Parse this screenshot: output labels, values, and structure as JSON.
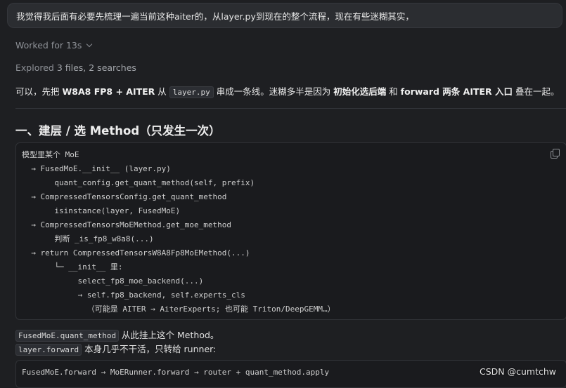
{
  "user_message": "我觉得我后面有必要先梳理一遍当前这种aiter的，从layer.py到现在的整个流程，现在有些迷糊其实，",
  "worked": {
    "label": "Worked for 13s"
  },
  "explored": {
    "label": "Explored",
    "detail": "3 files, 2 searches"
  },
  "summary": {
    "p1": "可以，先把 ",
    "b1": "W8A8 FP8 + AITER",
    "p2": " 从 ",
    "code": "layer.py",
    "p3": " 串成一条线。迷糊多半是因为 ",
    "b2": "初始化选后端",
    "p4": " 和 ",
    "b3": "forward 两条 AITER 入口",
    "p5": " 叠在一起。"
  },
  "heading": "一、建层 / 选 Method（只发生一次）",
  "code_lines": [
    "模型里某个 MoE",
    "  → FusedMoE.__init__ (layer.py)",
    "       quant_config.get_quant_method(self, prefix)",
    "  → CompressedTensorsConfig.get_quant_method",
    "       isinstance(layer, FusedMoE)",
    "  → CompressedTensorsMoEMethod.get_moe_method",
    "       判断 _is_fp8_w8a8(...)",
    "  → return CompressedTensorsW8A8Fp8MoEMethod(...)",
    "       └─ __init__ 里:",
    "            select_fp8_moe_backend(...)",
    "            → self.fp8_backend, self.experts_cls",
    "              （可能是 AITER → AiterExperts; 也可能 Triton/DeepGEMM…）"
  ],
  "note1": {
    "code": "FusedMoE.quant_method",
    "text": " 从此挂上这个 Method。"
  },
  "note2": {
    "code": "layer.forward",
    "text": " 本身几乎不干活，只转给 runner:"
  },
  "code2": "FusedMoE.forward → MoERunner.forward → router + quant_method.apply",
  "watermark": "CSDN @cumtchw"
}
